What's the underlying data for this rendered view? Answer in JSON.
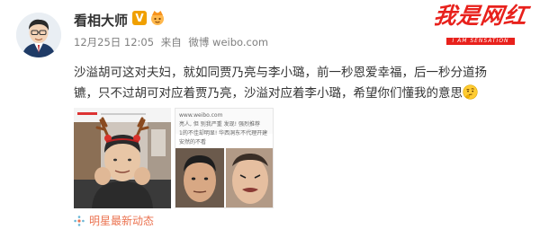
{
  "post": {
    "username": "看相大师",
    "verified_badge": "V",
    "timestamp": "12月25日 12:05",
    "source_prefix": "来自",
    "source": "微博 weibo.com",
    "body_line1": "沙溢胡可这对夫妇，就如同贾乃亮与李小璐，前一秒恩爱幸福，后一秒分道扬",
    "body_line2": "镳，只不过胡可对应着贾乃亮，沙溢对应着李小璐，希望你们懂我的意思",
    "emoji": "thinking-emoji",
    "topic": "明星最新动态",
    "topic_icon": "topic-spark-icon"
  },
  "watermark": {
    "text": "我是网红",
    "sub": "I AM SENSATION"
  },
  "thumbnail2": {
    "line1": "www.weibo.com",
    "line2": "亮人, 但 别我严重 发现! 强烈推荐",
    "line3": "1的不佳却明显! 华西洞东不代理开建",
    "line4": "安然的不看"
  },
  "colors": {
    "link": "#eb7350",
    "verified": "#f0a000",
    "watermark": "#e8211c",
    "meta": "#808080"
  }
}
